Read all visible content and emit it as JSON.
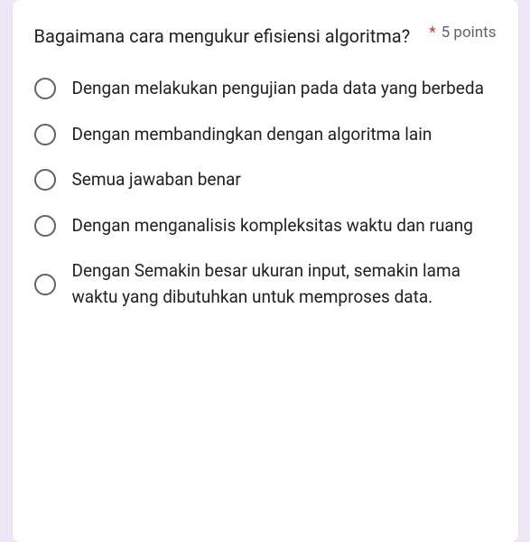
{
  "question": {
    "text": "Bagaimana cara mengukur efisiensi algoritma?",
    "required_mark": "*",
    "points_label": "5 points"
  },
  "options": [
    {
      "label": "Dengan melakukan pengujian pada data yang berbeda"
    },
    {
      "label": "Dengan membandingkan dengan algoritma lain"
    },
    {
      "label": "Semua jawaban benar"
    },
    {
      "label": "Dengan menganalisis kompleksitas waktu dan ruang"
    },
    {
      "label": "Dengan Semakin besar ukuran input, semakin lama waktu yang dibutuhkan untuk memproses data."
    }
  ]
}
